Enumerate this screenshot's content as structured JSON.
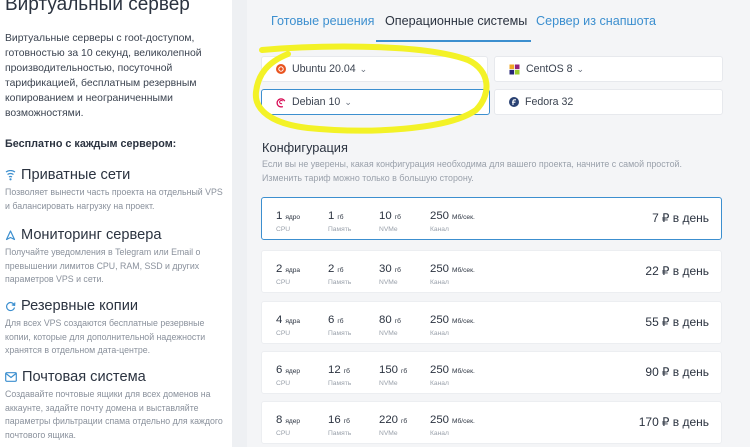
{
  "sidebar": {
    "title": "Виртуальный сервер",
    "description": "Виртуальные серверы с root-доступом, готовностью за 10 секунд, великолепной производительностью, посуточной тарификацией, бесплатным резервным копированием и неограниченными возможностями.",
    "free_heading": "Бесплатно с каждым сервером:",
    "features": [
      {
        "icon": "network-icon",
        "title": "Приватные сети",
        "description": "Позволяет вынести часть проекта на отдельный VPS и балансировать нагрузку на проект."
      },
      {
        "icon": "monitoring-icon",
        "title": "Мониторинг сервера",
        "description": "Получайте уведомления в Telegram или Email о превышении лимитов CPU, RAM, SSD и других параметров VPS и сети."
      },
      {
        "icon": "backup-icon",
        "title": "Резервные копии",
        "description": "Для всех VPS создаются бесплатные резервные копии, которые для дополнительной надежности хранятся в отдельном дата-центре."
      },
      {
        "icon": "mail-icon",
        "title": "Почтовая система",
        "description": "Создавайте почтовые ящики для всех доменов на аккаунте, задайте почту домена и выставляйте параметры фильтрации спама отдельно для каждого почтового ящика."
      }
    ]
  },
  "tabs": [
    {
      "label": "Готовые решения",
      "active": false
    },
    {
      "label": "Операционные системы",
      "active": true
    },
    {
      "label": "Сервер из снапшота",
      "active": false
    }
  ],
  "os_options": [
    {
      "name": "Ubuntu 20.04",
      "icon": "ubuntu-icon",
      "color": "#e95420",
      "selected": false,
      "has_dropdown": true
    },
    {
      "name": "CentOS 8",
      "icon": "centos-icon",
      "color": "#932279",
      "selected": false,
      "has_dropdown": true
    },
    {
      "name": "Debian 10",
      "icon": "debian-icon",
      "color": "#d70a53",
      "selected": true,
      "has_dropdown": true
    },
    {
      "name": "Fedora 32",
      "icon": "fedora-icon",
      "color": "#294172",
      "selected": false,
      "has_dropdown": false
    }
  ],
  "config": {
    "title": "Конфигурация",
    "hint": "Если вы не уверены, какая конфигурация необходима для вашего проекта, начните с самой простой. Изменить тариф можно только в большую сторону."
  },
  "spec_labels": {
    "cpu": "CPU",
    "ram": "Память",
    "disk": "NVMe",
    "net": "Канал"
  },
  "units": {
    "cpu": "ядро",
    "cpu_plural": "ядра",
    "ram": "гб",
    "disk": "гб",
    "net": "Мб/сек."
  },
  "price_suffix": "₽ в день",
  "plans": [
    {
      "cpu": "1",
      "cpu_unit": "ядро",
      "ram": "1",
      "disk": "10",
      "net": "250",
      "price": "7",
      "selected": true
    },
    {
      "cpu": "2",
      "cpu_unit": "ядра",
      "ram": "2",
      "disk": "30",
      "net": "250",
      "price": "22",
      "selected": false
    },
    {
      "cpu": "4",
      "cpu_unit": "ядра",
      "ram": "6",
      "disk": "80",
      "net": "250",
      "price": "55",
      "selected": false
    },
    {
      "cpu": "6",
      "cpu_unit": "ядер",
      "ram": "12",
      "disk": "150",
      "net": "250",
      "price": "90",
      "selected": false
    },
    {
      "cpu": "8",
      "cpu_unit": "ядер",
      "ram": "16",
      "disk": "220",
      "net": "250",
      "price": "170",
      "selected": false
    }
  ],
  "colors": {
    "accent": "#3c8fcf",
    "highlight": "#f3f227",
    "text": "#2b3340",
    "muted": "#9aa1ab"
  }
}
